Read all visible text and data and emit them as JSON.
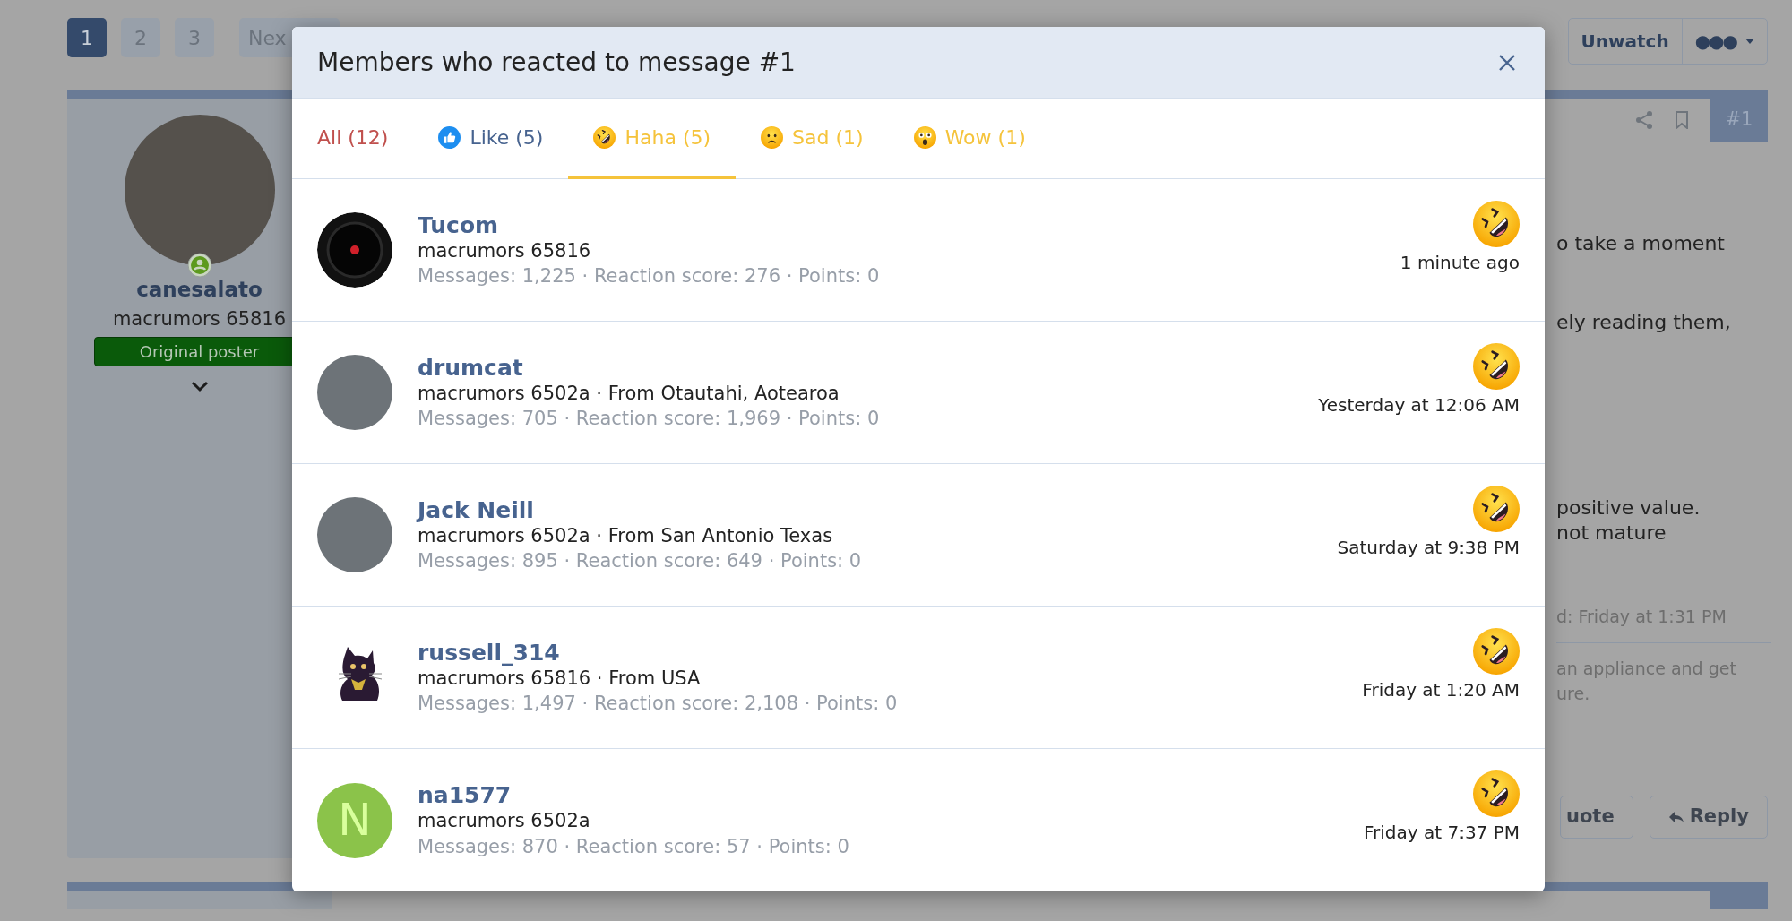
{
  "page": {
    "pagination": [
      {
        "label": "1",
        "selected": true
      },
      {
        "label": "2",
        "selected": false
      },
      {
        "label": "3",
        "selected": false
      },
      {
        "label": "Nex",
        "selected": false
      }
    ],
    "thread_buttons": [
      "Unwatch",
      "●●●"
    ],
    "post": {
      "author": {
        "name": "canesalato",
        "title": "macrumors 65816",
        "badge": "Original poster",
        "online": true
      },
      "number": "#1",
      "text_fragments": [
        "o take a moment",
        "ely reading them,",
        "positive value.",
        "not mature"
      ],
      "edited": "d: Friday at 1:31 PM",
      "signature": [
        "an appliance and get",
        "ure."
      ],
      "buttons": [
        "uote",
        "Reply"
      ]
    }
  },
  "modal": {
    "title": "Members who reacted to message #1",
    "tabs": [
      {
        "kind": "all",
        "label": "All (12)",
        "selected": false
      },
      {
        "kind": "like",
        "label": "Like (5)",
        "selected": false
      },
      {
        "kind": "haha",
        "label": "Haha (5)",
        "selected": true
      },
      {
        "kind": "sad",
        "label": "Sad (1)",
        "selected": false
      },
      {
        "kind": "wow",
        "label": "Wow (1)",
        "selected": false
      }
    ],
    "members": [
      {
        "avatar": {
          "kind": "lens"
        },
        "name": "Tucom",
        "title": "macrumors 65816",
        "stats": "Messages: 1,225 · Reaction score: 276 · Points: 0",
        "reaction": {
          "kind": "haha"
        },
        "time": "1 minute ago"
      },
      {
        "avatar": {
          "kind": "photo"
        },
        "name": "drumcat",
        "title": "macrumors 6502a · From Otautahi, Aotearoa",
        "stats": "Messages: 705 · Reaction score: 1,969 · Points: 0",
        "reaction": {
          "kind": "haha"
        },
        "time": "Yesterday at 12:06 AM"
      },
      {
        "avatar": {
          "kind": "photo"
        },
        "name": "Jack Neill",
        "title": "macrumors 6502a · From San Antonio Texas",
        "stats": "Messages: 895 · Reaction score: 649 · Points: 0",
        "reaction": {
          "kind": "haha"
        },
        "time": "Saturday at 9:38 PM"
      },
      {
        "avatar": {
          "kind": "cat"
        },
        "name": "russell_314",
        "title": "macrumors 65816 · From USA",
        "stats": "Messages: 1,497 · Reaction score: 2,108 · Points: 0",
        "reaction": {
          "kind": "haha"
        },
        "time": "Friday at 1:20 AM"
      },
      {
        "avatar": {
          "kind": "letter",
          "initial": "N"
        },
        "name": "na1577",
        "title": "macrumors 6502a",
        "stats": "Messages: 870 · Reaction score: 57 · Points: 0",
        "reaction": {
          "kind": "haha"
        },
        "time": "Friday at 7:37 PM"
      }
    ]
  }
}
